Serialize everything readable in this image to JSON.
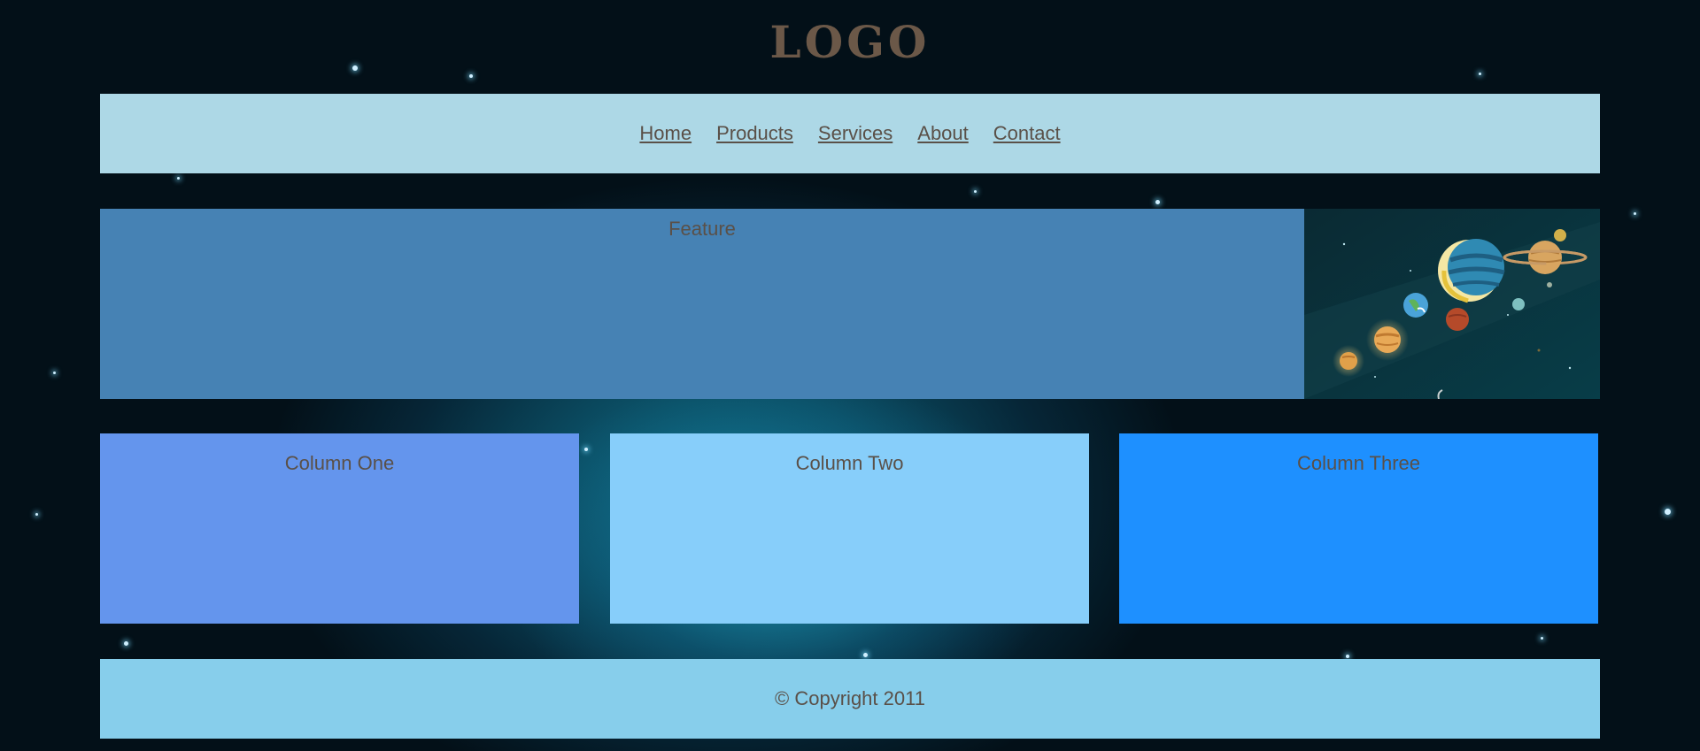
{
  "logo": {
    "text": "LOGO",
    "color": "#6b5848"
  },
  "nav": {
    "background": "#add8e6",
    "items": [
      {
        "label": "Home"
      },
      {
        "label": "Products"
      },
      {
        "label": "Services"
      },
      {
        "label": "About"
      },
      {
        "label": "Contact"
      }
    ]
  },
  "feature": {
    "label": "Feature",
    "background": "#4682b4",
    "image": "solar-system-illustration"
  },
  "columns": [
    {
      "label": "Column One",
      "background": "#6495ed"
    },
    {
      "label": "Column Two",
      "background": "#87cefa"
    },
    {
      "label": "Column Three",
      "background": "#1e90ff"
    }
  ],
  "footer": {
    "text": "© Copyright 2011",
    "background": "#87ceeb"
  },
  "page": {
    "background": "starfield-nebula",
    "text_color": "#5a5048"
  }
}
